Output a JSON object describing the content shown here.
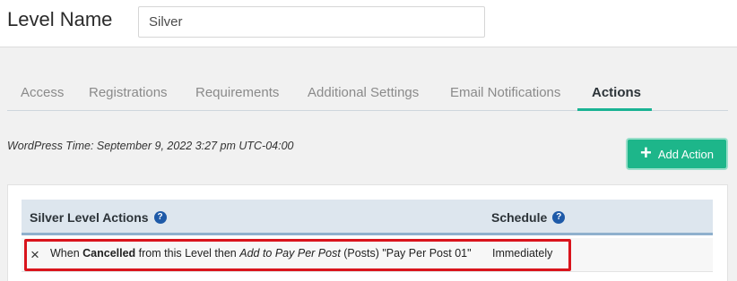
{
  "header": {
    "label": "Level Name",
    "level_name_value": "Silver"
  },
  "tabs": [
    {
      "label": "Access",
      "active": false
    },
    {
      "label": "Registrations",
      "active": false
    },
    {
      "label": "Requirements",
      "active": false
    },
    {
      "label": "Additional Settings",
      "active": false
    },
    {
      "label": "Email Notifications",
      "active": false
    },
    {
      "label": "Actions",
      "active": true
    }
  ],
  "wp_time": "WordPress Time: September 9, 2022 3:27 pm UTC-04:00",
  "add_action": {
    "label": "Add Action",
    "icon": "plus-icon"
  },
  "table": {
    "col_actions": "Silver Level Actions",
    "col_schedule": "Schedule",
    "rows": [
      {
        "remove_icon": "×",
        "parts": {
          "p1": "When ",
          "p2": "Cancelled",
          "p3": " from this Level then ",
          "p4": "Add to Pay Per Post",
          "p5": " (Posts) \"Pay Per Post 01\""
        },
        "schedule": "Immediately"
      }
    ]
  },
  "colors": {
    "accent": "#1db68a",
    "tab_underline": "#1ab394",
    "highlight": "#d9141c",
    "help_icon": "#1e5aa8"
  }
}
